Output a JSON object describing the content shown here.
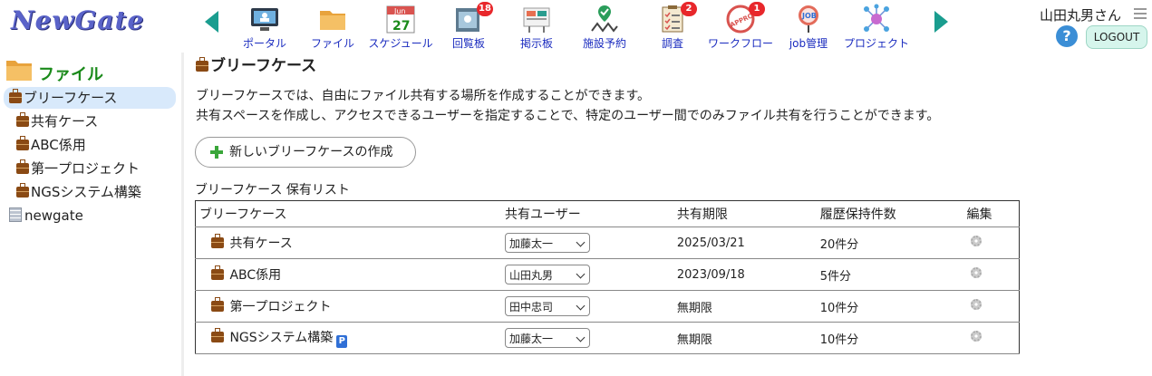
{
  "app": {
    "logo": "NewGate"
  },
  "nav": {
    "items": [
      {
        "label": "ポータル",
        "icon": "portal-icon",
        "badge": ""
      },
      {
        "label": "ファイル",
        "icon": "folder-icon",
        "badge": ""
      },
      {
        "label": "スケジュール",
        "icon": "calendar-icon",
        "badge": "",
        "cal_month": "Jun",
        "cal_day": "27"
      },
      {
        "label": "回覧板",
        "icon": "circular-board-icon",
        "badge": "18"
      },
      {
        "label": "掲示板",
        "icon": "bulletin-board-icon",
        "badge": ""
      },
      {
        "label": "施設予約",
        "icon": "facility-booking-icon",
        "badge": ""
      },
      {
        "label": "調査",
        "icon": "survey-icon",
        "badge": "2"
      },
      {
        "label": "ワークフロー",
        "icon": "workflow-icon",
        "badge": "1",
        "stamp": "APPROVED"
      },
      {
        "label": "job管理",
        "icon": "job-management-icon",
        "badge": "",
        "pin": "JOB"
      },
      {
        "label": "プロジェクト",
        "icon": "project-icon",
        "badge": ""
      }
    ]
  },
  "user": {
    "name": "山田丸男さん",
    "help": "?",
    "logout": "LOGOUT"
  },
  "sidebar": {
    "title": "ファイル",
    "items": [
      {
        "label": "ブリーフケース"
      },
      {
        "label": "共有ケース"
      },
      {
        "label": "ABC係用"
      },
      {
        "label": "第一プロジェクト"
      },
      {
        "label": "NGSシステム構築"
      },
      {
        "label": "newgate"
      }
    ]
  },
  "main": {
    "title": "ブリーフケース",
    "desc1": "ブリーフケースでは、自由にファイル共有する場所を作成することができます。",
    "desc2": "共有スペースを作成し、アクセスできるユーザーを指定することで、特定のユーザー間でのみファイル共有を行うことができます。",
    "create_button": "新しいブリーフケースの作成",
    "list_caption": "ブリーフケース 保有リスト",
    "table": {
      "headers": [
        "ブリーフケース",
        "共有ユーザー",
        "共有期限",
        "履歴保持件数",
        "編集"
      ],
      "rows": [
        {
          "name": "共有ケース",
          "user": "加藤太一",
          "expiry": "2025/03/21",
          "history": "20件分",
          "p_badge": ""
        },
        {
          "name": "ABC係用",
          "user": "山田丸男",
          "expiry": "2023/09/18",
          "history": "5件分",
          "p_badge": ""
        },
        {
          "name": "第一プロジェクト",
          "user": "田中忠司",
          "expiry": "無期限",
          "history": "10件分",
          "p_badge": ""
        },
        {
          "name": "NGSシステム構築",
          "user": "加藤太一",
          "expiry": "無期限",
          "history": "10件分",
          "p_badge": "P"
        }
      ]
    }
  }
}
